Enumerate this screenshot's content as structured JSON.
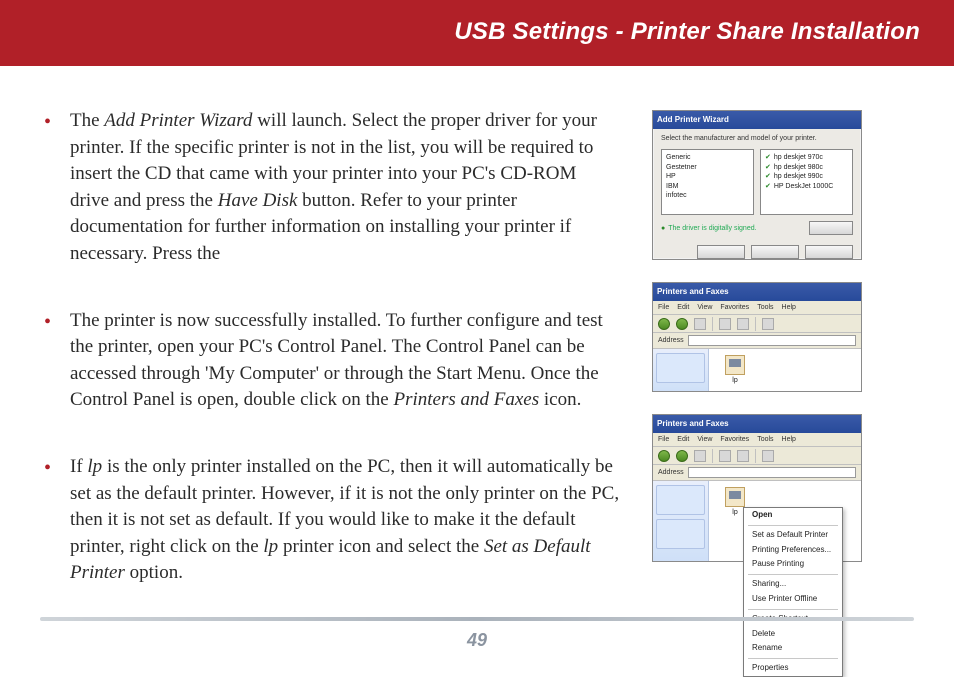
{
  "header": {
    "title": "USB Settings - Printer Share Installation"
  },
  "bullets": [
    {
      "pre": "The ",
      "em1": "Add Printer Wizard",
      "mid1": " will launch.  Select the proper driver for your printer.  If the specific printer is not in the list, you will be required to insert the CD that came with your printer into your PC's CD-ROM drive and press the ",
      "em2": "Have Disk",
      "post": " button.  Refer to your printer documentation for further information on installing your printer if necessary.  Press the"
    },
    {
      "pre": "The printer is now successfully installed.  To further configure and test the printer, open your PC's Control Panel.  The Control Panel can be accessed through 'My Computer' or through the Start Menu.  Once the Control Panel is open, double click on the ",
      "em1": "Printers and Faxes",
      "post": " icon."
    },
    {
      "pre": "If ",
      "em1": "lp",
      "mid1": " is the only printer installed on the PC, then it will automatically be set as the default printer.  However, if it is not the only printer on the PC, then it is not set as default.  If you would like to make it the default printer, right click on the ",
      "em2": "lp",
      "mid2": " printer icon and select the ",
      "em3": "Set as Default Printer",
      "post": " option."
    }
  ],
  "shots": {
    "wizard": {
      "title": "Add Printer Wizard",
      "hint": "The driver is digitally signed."
    },
    "explorer_pf": {
      "title": "Printers and Faxes",
      "menus": [
        "File",
        "Edit",
        "View",
        "Favorites",
        "Tools",
        "Help"
      ],
      "addr_label": "Address",
      "icon_label": "lp"
    },
    "explorer_ctx": {
      "title": "Printers and Faxes",
      "menus": [
        "File",
        "Edit",
        "View",
        "Favorites",
        "Tools",
        "Help"
      ],
      "addr_label": "Address",
      "icon_label": "lp",
      "context_items": [
        "Open",
        "Set as Default Printer",
        "Printing Preferences...",
        "Pause Printing",
        "Sharing...",
        "Use Printer Offline",
        "Create Shortcut",
        "Delete",
        "Rename",
        "Properties"
      ]
    }
  },
  "page_number": "49"
}
